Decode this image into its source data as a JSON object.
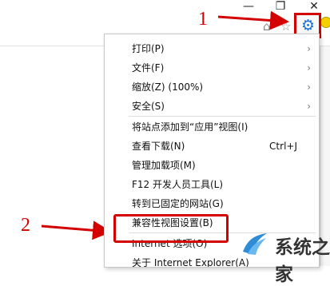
{
  "window": {
    "controls": {
      "minimize": "—",
      "restore": "❐",
      "close": "✕"
    }
  },
  "callouts": {
    "one": "1",
    "two": "2"
  },
  "menu": {
    "items": [
      {
        "label": "打印(P)",
        "submenu": true
      },
      {
        "label": "文件(F)",
        "submenu": true
      },
      {
        "label": "缩放(Z) (100%)",
        "submenu": true
      },
      {
        "label": "安全(S)",
        "submenu": true
      },
      {
        "label": "将站点添加到“应用”视图(I)",
        "submenu": false
      },
      {
        "label": "查看下载(N)",
        "shortcut": "Ctrl+J",
        "submenu": false
      },
      {
        "label": "管理加载项(M)",
        "submenu": false
      },
      {
        "label": "F12 开发人员工具(L)",
        "submenu": false
      },
      {
        "label": "转到已固定的网站(G)",
        "submenu": false
      },
      {
        "label": "兼容性视图设置(B)",
        "submenu": false
      },
      {
        "label": "Internet 选项(O)",
        "submenu": false
      },
      {
        "label": "关于 Internet Explorer(A)",
        "submenu": false
      }
    ]
  },
  "watermark": {
    "text": "系统之家"
  },
  "colors": {
    "accent": "#d20000",
    "gear": "#1a73d9"
  }
}
